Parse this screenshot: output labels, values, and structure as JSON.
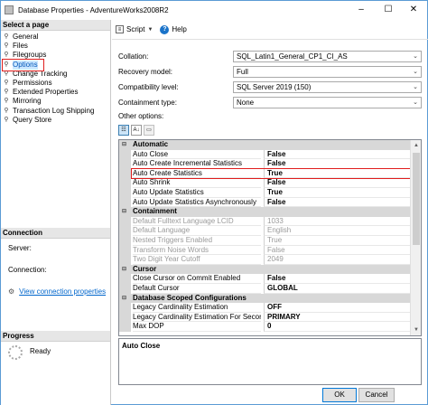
{
  "window": {
    "title": "Database Properties - AdventureWorks2008R2",
    "minimize": "–",
    "maximize": "☐",
    "close": "✕"
  },
  "select_page": {
    "header": "Select a page",
    "items": [
      {
        "label": "General",
        "icon": "page-icon"
      },
      {
        "label": "Files",
        "icon": "page-icon"
      },
      {
        "label": "Filegroups",
        "icon": "page-icon"
      },
      {
        "label": "Options",
        "icon": "page-icon",
        "selected": true
      },
      {
        "label": "Change Tracking",
        "icon": "page-icon"
      },
      {
        "label": "Permissions",
        "icon": "page-icon"
      },
      {
        "label": "Extended Properties",
        "icon": "page-icon"
      },
      {
        "label": "Mirroring",
        "icon": "page-icon"
      },
      {
        "label": "Transaction Log Shipping",
        "icon": "page-icon"
      },
      {
        "label": "Query Store",
        "icon": "page-icon"
      }
    ]
  },
  "connection": {
    "header": "Connection",
    "server_label": "Server:",
    "connection_label": "Connection:",
    "view_link": "View connection properties"
  },
  "progress": {
    "header": "Progress",
    "status": "Ready"
  },
  "toolbar": {
    "script_label": "Script",
    "help_label": "Help"
  },
  "fields": {
    "collation": {
      "label": "Collation:",
      "value": "SQL_Latin1_General_CP1_CI_AS"
    },
    "recovery_model": {
      "label": "Recovery model:",
      "value": "Full"
    },
    "compatibility_level": {
      "label": "Compatibility level:",
      "value": "SQL Server 2019 (150)"
    },
    "containment_type": {
      "label": "Containment type:",
      "value": "None"
    }
  },
  "other_options_label": "Other options:",
  "grid": {
    "rows": [
      {
        "kind": "cat",
        "name": "Automatic"
      },
      {
        "kind": "prop",
        "name": "Auto Close",
        "value": "False"
      },
      {
        "kind": "prop",
        "name": "Auto Create Incremental Statistics",
        "value": "False"
      },
      {
        "kind": "prop",
        "name": "Auto Create Statistics",
        "value": "True",
        "highlight": true
      },
      {
        "kind": "prop",
        "name": "Auto Shrink",
        "value": "False"
      },
      {
        "kind": "prop",
        "name": "Auto Update Statistics",
        "value": "True"
      },
      {
        "kind": "prop",
        "name": "Auto Update Statistics Asynchronously",
        "value": "False"
      },
      {
        "kind": "cat",
        "name": "Containment"
      },
      {
        "kind": "prop",
        "name": "Default Fulltext Language LCID",
        "value": "1033",
        "dim": true
      },
      {
        "kind": "prop",
        "name": "Default Language",
        "value": "English",
        "dim": true
      },
      {
        "kind": "prop",
        "name": "Nested Triggers Enabled",
        "value": "True",
        "dim": true
      },
      {
        "kind": "prop",
        "name": "Transform Noise Words",
        "value": "False",
        "dim": true
      },
      {
        "kind": "prop",
        "name": "Two Digit Year Cutoff",
        "value": "2049",
        "dim": true
      },
      {
        "kind": "cat",
        "name": "Cursor"
      },
      {
        "kind": "prop",
        "name": "Close Cursor on Commit Enabled",
        "value": "False"
      },
      {
        "kind": "prop",
        "name": "Default Cursor",
        "value": "GLOBAL"
      },
      {
        "kind": "cat",
        "name": "Database Scoped Configurations"
      },
      {
        "kind": "prop",
        "name": "Legacy Cardinality Estimation",
        "value": "OFF"
      },
      {
        "kind": "prop",
        "name": "Legacy Cardinality Estimation For Secondary",
        "value": "PRIMARY"
      },
      {
        "kind": "prop",
        "name": "Max DOP",
        "value": "0"
      }
    ]
  },
  "description": {
    "title": "Auto Close"
  },
  "buttons": {
    "ok": "OK",
    "cancel": "Cancel"
  },
  "colors": {
    "highlight_border": "#e01e1e",
    "accent": "#0078d7"
  }
}
